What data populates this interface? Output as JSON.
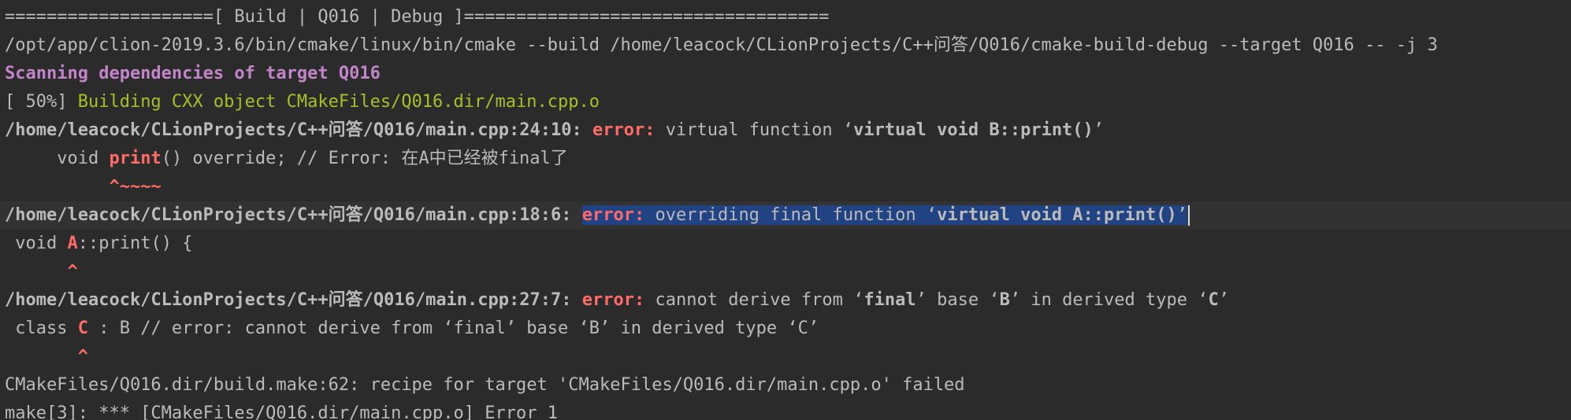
{
  "console": {
    "header": "====================[ Build | Q016 | Debug ]===================================",
    "command": "/opt/app/clion-2019.3.6/bin/cmake/linux/bin/cmake --build /home/leacock/CLionProjects/C++问答/Q016/cmake-build-debug --target Q016 -- -j 3",
    "scanning": "Scanning dependencies of target Q016",
    "building_progress": "[ 50%] ",
    "building_text": "Building CXX object CMakeFiles/Q016.dir/main.cpp.o",
    "error1": {
      "location": "/home/leacock/CLionProjects/C++问答/Q016/main.cpp:24:10: ",
      "label": "error:",
      "msg_prefix": " virtual function ‘",
      "msg_bold": "virtual void B::print()",
      "msg_suffix": "’",
      "code_prefix": "     void ",
      "code_hl": "print",
      "code_suffix": "() override; // Error: 在A中已经被final了",
      "marker": "          ^~~~~"
    },
    "error2": {
      "location": "/home/leacock/CLionProjects/C++问答/Q016/main.cpp:18:6: ",
      "label": "error:",
      "msg_prefix": " overriding final function ‘",
      "msg_bold": "virtual void A::print()",
      "msg_suffix": "’",
      "code_prefix": " void ",
      "code_hl": "A",
      "code_suffix": "::print() {",
      "marker": "      ^"
    },
    "error3": {
      "location": "/home/leacock/CLionProjects/C++问答/Q016/main.cpp:27:7: ",
      "label": "error:",
      "msg_a": " cannot derive from ‘",
      "msg_b": "final",
      "msg_c": "’ base ‘",
      "msg_d": "B",
      "msg_e": "’ in derived type ‘",
      "msg_f": "C",
      "msg_g": "’",
      "code_prefix": " class ",
      "code_hl": "C",
      "code_suffix": " : B // error: cannot derive from ‘final’ base ‘B’ in derived type ‘C’",
      "marker": "       ^"
    },
    "recipe_fail": "CMakeFiles/Q016.dir/build.make:62: recipe for target 'CMakeFiles/Q016.dir/main.cpp.o' failed",
    "make_error": "make[3]: *** [CMakeFiles/Q016.dir/main.cpp.o] Error 1"
  },
  "colors": {
    "background": "#2b2b2b",
    "text": "#bbbbbb",
    "error": "#ff6b68",
    "scanning": "#c285c9",
    "building": "#a8c023",
    "selection": "#214283"
  }
}
